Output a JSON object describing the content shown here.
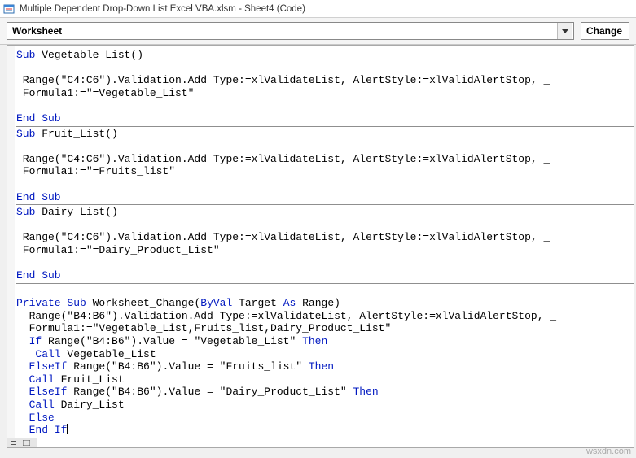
{
  "titlebar": {
    "app_icon": "excel-module-icon",
    "title": "Multiple Dependent Drop-Down List Excel VBA.xlsm - Sheet4 (Code)"
  },
  "toolbar": {
    "object_box": "Worksheet",
    "procedure_box": "Change"
  },
  "code_blocks": [
    {
      "lines": [
        [
          [
            "kw",
            "Sub"
          ],
          [
            "txt",
            " Vegetable_List()"
          ]
        ],
        [
          [
            "txt",
            ""
          ]
        ],
        [
          [
            "txt",
            " Range(\"C4:C6\").Validation.Add Type:=xlValidateList, AlertStyle:=xlValidAlertStop, _"
          ]
        ],
        [
          [
            "txt",
            " Formula1:=\"=Vegetable_List\""
          ]
        ],
        [
          [
            "txt",
            ""
          ]
        ],
        [
          [
            "kw",
            "End Sub"
          ]
        ]
      ]
    },
    {
      "lines": [
        [
          [
            "kw",
            "Sub"
          ],
          [
            "txt",
            " Fruit_List()"
          ]
        ],
        [
          [
            "txt",
            ""
          ]
        ],
        [
          [
            "txt",
            " Range(\"C4:C6\").Validation.Add Type:=xlValidateList, AlertStyle:=xlValidAlertStop, _"
          ]
        ],
        [
          [
            "txt",
            " Formula1:=\"=Fruits_list\""
          ]
        ],
        [
          [
            "txt",
            ""
          ]
        ],
        [
          [
            "kw",
            "End Sub"
          ]
        ]
      ]
    },
    {
      "lines": [
        [
          [
            "kw",
            "Sub"
          ],
          [
            "txt",
            " Dairy_List()"
          ]
        ],
        [
          [
            "txt",
            ""
          ]
        ],
        [
          [
            "txt",
            " Range(\"C4:C6\").Validation.Add Type:=xlValidateList, AlertStyle:=xlValidAlertStop, _"
          ]
        ],
        [
          [
            "txt",
            " Formula1:=\"=Dairy_Product_List\""
          ]
        ],
        [
          [
            "txt",
            ""
          ]
        ],
        [
          [
            "kw",
            "End Sub"
          ]
        ]
      ]
    },
    {
      "lines": [
        [
          [
            "txt",
            ""
          ]
        ],
        [
          [
            "kw",
            "Private Sub"
          ],
          [
            "txt",
            " Worksheet_Change("
          ],
          [
            "kw",
            "ByVal"
          ],
          [
            "txt",
            " Target "
          ],
          [
            "kw",
            "As"
          ],
          [
            "txt",
            " Range)"
          ]
        ],
        [
          [
            "txt",
            "  Range(\"B4:B6\").Validation.Add Type:=xlValidateList, AlertStyle:=xlValidAlertStop, _"
          ]
        ],
        [
          [
            "txt",
            "  Formula1:=\"Vegetable_List,Fruits_list,Dairy_Product_List\""
          ]
        ],
        [
          [
            "txt",
            "  "
          ],
          [
            "kw",
            "If"
          ],
          [
            "txt",
            " Range(\"B4:B6\").Value = \"Vegetable_List\" "
          ],
          [
            "kw",
            "Then"
          ]
        ],
        [
          [
            "txt",
            "   "
          ],
          [
            "kw",
            "Call"
          ],
          [
            "txt",
            " Vegetable_List"
          ]
        ],
        [
          [
            "txt",
            "  "
          ],
          [
            "kw",
            "ElseIf"
          ],
          [
            "txt",
            " Range(\"B4:B6\").Value = \"Fruits_list\" "
          ],
          [
            "kw",
            "Then"
          ]
        ],
        [
          [
            "txt",
            "  "
          ],
          [
            "kw",
            "Call"
          ],
          [
            "txt",
            " Fruit_List"
          ]
        ],
        [
          [
            "txt",
            "  "
          ],
          [
            "kw",
            "ElseIf"
          ],
          [
            "txt",
            " Range(\"B4:B6\").Value = \"Dairy_Product_List\" "
          ],
          [
            "kw",
            "Then"
          ]
        ],
        [
          [
            "txt",
            "  "
          ],
          [
            "kw",
            "Call"
          ],
          [
            "txt",
            " Dairy_List"
          ]
        ],
        [
          [
            "txt",
            "  "
          ],
          [
            "kw",
            "Else"
          ]
        ],
        [
          [
            "txt",
            "  "
          ],
          [
            "kw",
            "End If"
          ],
          [
            "cur",
            ""
          ]
        ]
      ]
    }
  ],
  "watermark": "wsxdn.com"
}
